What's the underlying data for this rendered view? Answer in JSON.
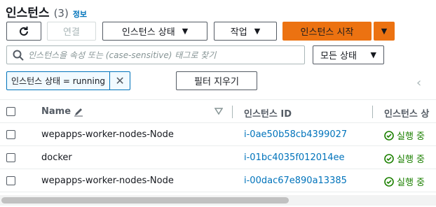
{
  "header": {
    "title": "인스턴스",
    "count": "(3)",
    "info": "정보"
  },
  "toolbar": {
    "connect": "연결",
    "instance_state": "인스턴스 상태",
    "actions": "작업",
    "launch": "인스턴스 시작",
    "caret": "▼"
  },
  "search": {
    "placeholder": "인스턴스을 속성 또는 (case-sensitive) 태그로 찾기",
    "value": ""
  },
  "state_filter": {
    "selected": "모든 상태"
  },
  "filter_token": {
    "label": "인스턴스 상태 = running",
    "remove": "✕"
  },
  "clear_filters": "필터 지우기",
  "pager": {
    "prev": "‹"
  },
  "table": {
    "columns": {
      "name": "Name",
      "instance_id": "인스턴스 ID",
      "instance_state": "인스턴스 상"
    },
    "rows": [
      {
        "name": "wepapps-worker-nodes-Node",
        "instance_id": "i-0ae50b58cb4399027",
        "state": "실행 중"
      },
      {
        "name": "docker",
        "instance_id": "i-01bc4035f012014ee",
        "state": "실행 중"
      },
      {
        "name": "wepapps-worker-nodes-Node",
        "instance_id": "i-00dac67e890a13385",
        "state": "실행 중"
      }
    ]
  },
  "colors": {
    "primary": "#ec7211",
    "link": "#0073bb",
    "success": "#1d8102"
  }
}
